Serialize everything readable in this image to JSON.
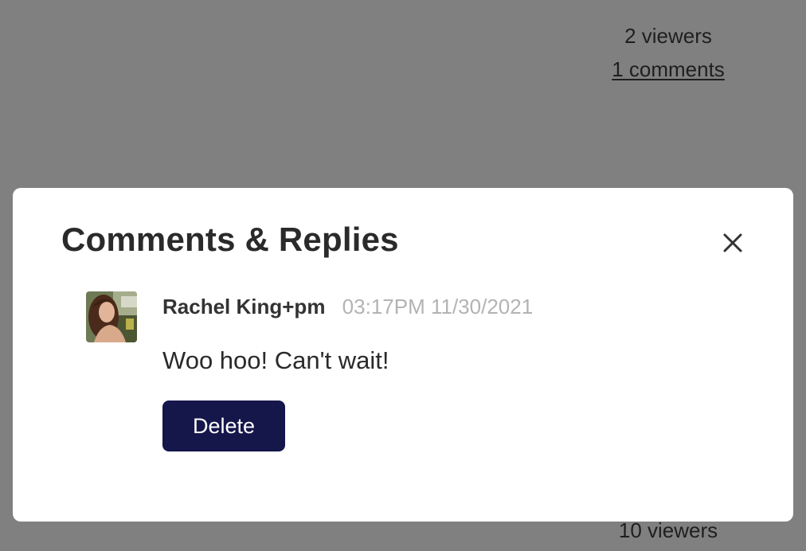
{
  "background": {
    "top_stats": {
      "viewers": "2 viewers",
      "comments": "1 comments"
    },
    "bottom_stats": {
      "viewers": "10 viewers"
    }
  },
  "modal": {
    "title": "Comments & Replies",
    "close_icon": "close-icon",
    "comments": [
      {
        "author": "Rachel King+pm",
        "timestamp": "03:17PM 11/30/2021",
        "body": "Woo hoo! Can't wait!",
        "delete_label": "Delete"
      }
    ]
  },
  "colors": {
    "overlay": "#808080",
    "button_bg": "#15164a",
    "timestamp": "#b3b3b3"
  }
}
